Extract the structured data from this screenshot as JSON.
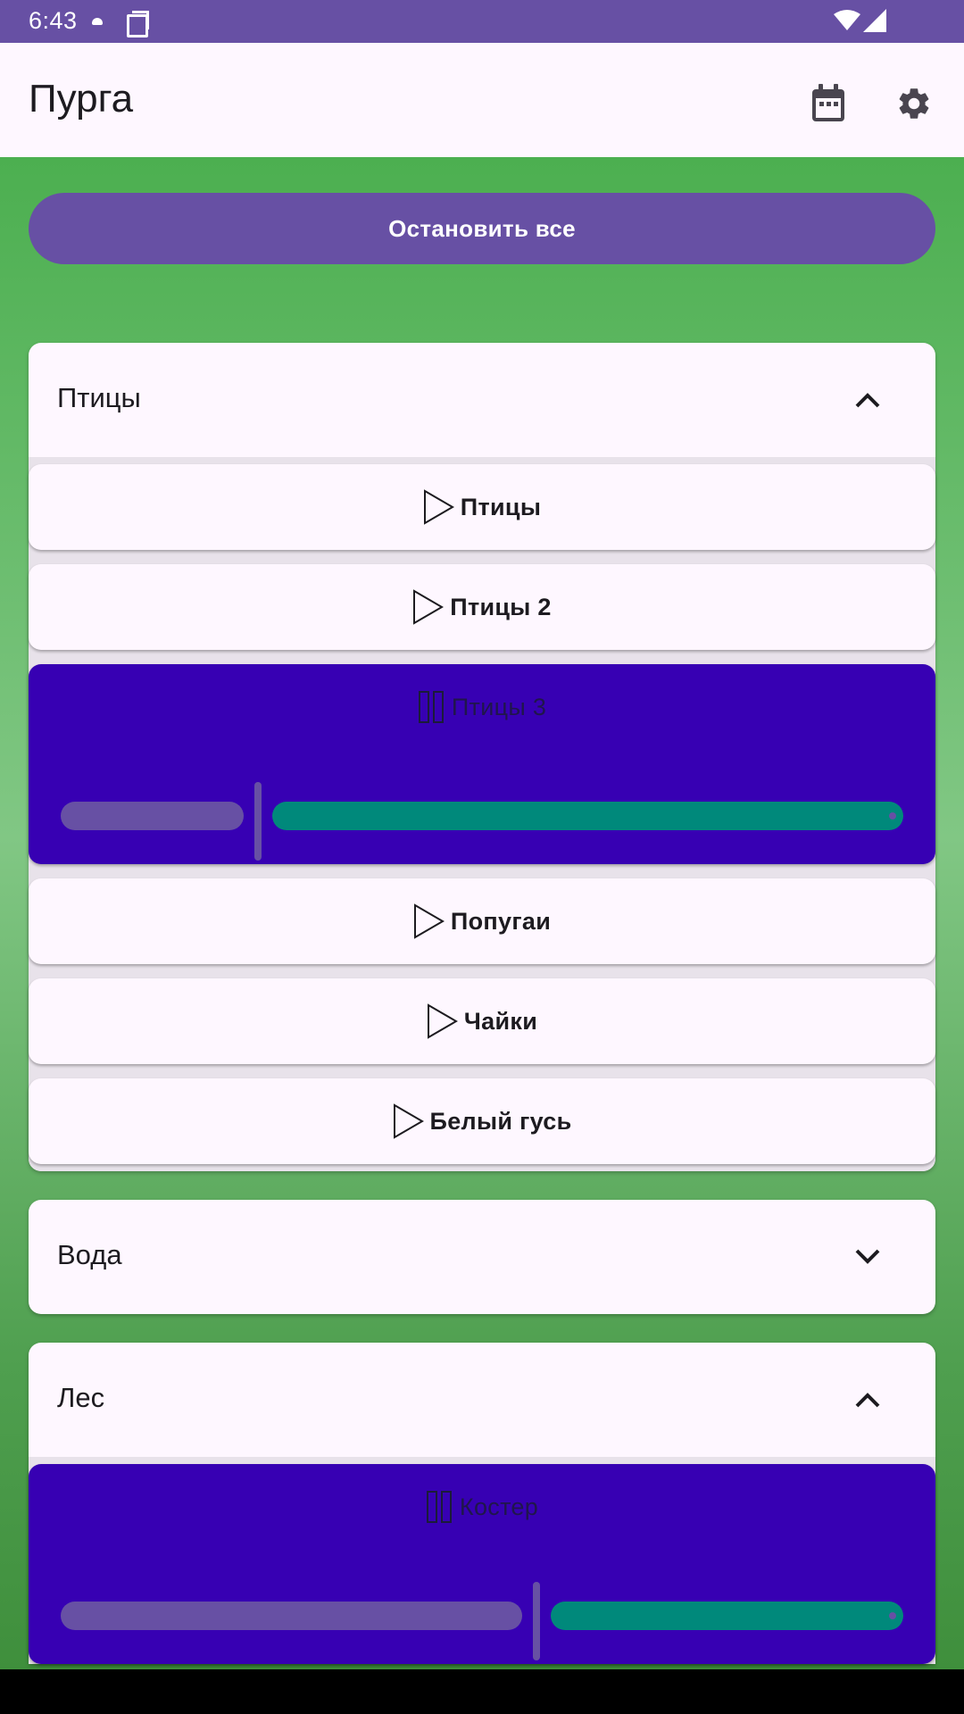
{
  "status": {
    "time": "6:43"
  },
  "app": {
    "title": "Пурга"
  },
  "stop_all_label": "Остановить все",
  "colors": {
    "primary": "#6750a4",
    "active_card": "#3700b3",
    "slider_active": "#00897b",
    "background_green": "#4caf50"
  },
  "groups": [
    {
      "title": "Птицы",
      "expanded": true,
      "sounds": [
        {
          "label": "Птицы",
          "playing": false
        },
        {
          "label": "Птицы 2",
          "playing": false
        },
        {
          "label": "Птицы 3",
          "playing": true,
          "volume": 0.23
        },
        {
          "label": "Попугаи",
          "playing": false
        },
        {
          "label": "Чайки",
          "playing": false
        },
        {
          "label": "Белый гусь",
          "playing": false
        }
      ]
    },
    {
      "title": "Вода",
      "expanded": false,
      "sounds": []
    },
    {
      "title": "Лес",
      "expanded": true,
      "sounds": [
        {
          "label": "Костер",
          "playing": true,
          "volume": 0.56
        }
      ]
    }
  ]
}
